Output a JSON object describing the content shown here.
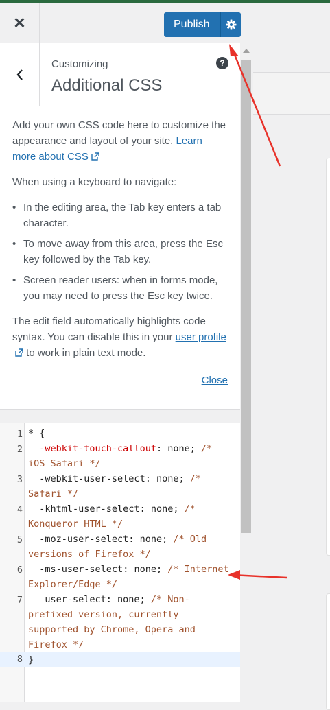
{
  "header": {
    "close_glyph": "✕",
    "publish_label": "Publish"
  },
  "section": {
    "breadcrumb": "Customizing",
    "title": "Additional CSS",
    "help_glyph": "?"
  },
  "description": {
    "intro": "Add your own CSS code here to customize the appearance and layout of your site.",
    "learn_more_link": "Learn more about CSS",
    "keyboard_heading": "When using a keyboard to navigate:",
    "bullets": [
      "In the editing area, the Tab key enters a tab character.",
      "To move away from this area, press the Esc key followed by the Tab key.",
      "Screen reader users: when in forms mode, you may need to press the Esc key twice."
    ],
    "syntax_text": "The edit field automatically highlights code syntax. You can disable this in your",
    "user_profile_link": "user profile",
    "syntax_suffix": "to work in plain text mode.",
    "close_link": "Close"
  },
  "editor": {
    "line_numbers": [
      "1",
      "2",
      "3",
      "4",
      "5",
      "6",
      "7",
      "8"
    ],
    "l1": "* {",
    "l2_prop": "  -webkit-touch-callout",
    "l2_rest": ": none; ",
    "l2_comment": "/* iOS Safari */",
    "l3_prop": "  -webkit-user-select",
    "l3_rest": ": none; ",
    "l3_comment": "/* Safari */",
    "l4_prop": "  -khtml-user-select",
    "l4_rest": ": none; ",
    "l4_comment": "/* Konqueror HTML */",
    "l5_prop": "  -moz-user-select",
    "l5_rest": ": none; ",
    "l5_comment": "/* Old versions of Firefox */",
    "l6_prop": "  -ms-user-select",
    "l6_rest": ": none; ",
    "l6_comment": "/* Internet Explorer/Edge */",
    "l7_prop": "   user-select",
    "l7_rest": ": none; ",
    "l7_comment": "/* Non-prefixed version, currently supported by Chrome, Opera and Firefox */",
    "l8": "}"
  },
  "colors": {
    "publish_bg": "#2271b1",
    "annotation_arrow": "#e8322a",
    "top_stripe": "#2b6a3f"
  },
  "icons": {
    "close": "close-icon",
    "settings": "gear-icon",
    "back": "chevron-left-icon",
    "help": "help-icon",
    "external": "external-link-icon"
  }
}
